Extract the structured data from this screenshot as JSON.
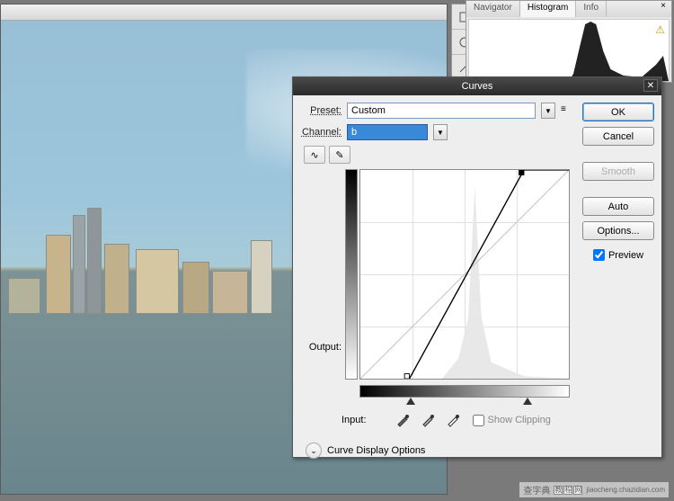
{
  "right_panel": {
    "tabs": [
      "Navigator",
      "Histogram",
      "Info"
    ],
    "active_tab": 1,
    "tab_close": "×",
    "warning_icon": "⚠"
  },
  "dialog": {
    "title": "Curves",
    "preset_label": "Preset:",
    "preset_value": "Custom",
    "preset_menu_icon": "≡",
    "channel_label": "Channel:",
    "channel_value": "b",
    "curve_tool_icon": "∿",
    "pencil_tool_icon": "✎",
    "output_label": "Output:",
    "input_label": "Input:",
    "eyedropper_black": "✒",
    "eyedropper_gray": "✒",
    "eyedropper_white": "✒",
    "show_clipping_label": "Show Clipping",
    "show_clipping_checked": false,
    "expand_icon": "⌄",
    "expand_label": "Curve Display Options",
    "buttons": {
      "ok": "OK",
      "cancel": "Cancel",
      "smooth": "Smooth",
      "auto": "Auto",
      "options": "Options..."
    },
    "preview_label": "Preview",
    "preview_checked": true,
    "close_icon": "✕",
    "dropdown_icon": "▼"
  },
  "chart_data": {
    "type": "line",
    "title": "Curves",
    "xlabel": "Input",
    "ylabel": "Output",
    "xlim": [
      0,
      255
    ],
    "ylim": [
      0,
      255
    ],
    "series": [
      {
        "name": "curve",
        "x": [
          60,
          200,
          255
        ],
        "y": [
          0,
          255,
          255
        ]
      },
      {
        "name": "baseline",
        "x": [
          0,
          255
        ],
        "y": [
          0,
          255
        ]
      }
    ],
    "histogram_peak_input": 140,
    "black_point_input": 60,
    "white_point_input": 200
  },
  "watermark": {
    "text": "查字典",
    "chars": [
      "教",
      "程",
      "网"
    ],
    "url": "jiaocheng.chazidian.com"
  }
}
